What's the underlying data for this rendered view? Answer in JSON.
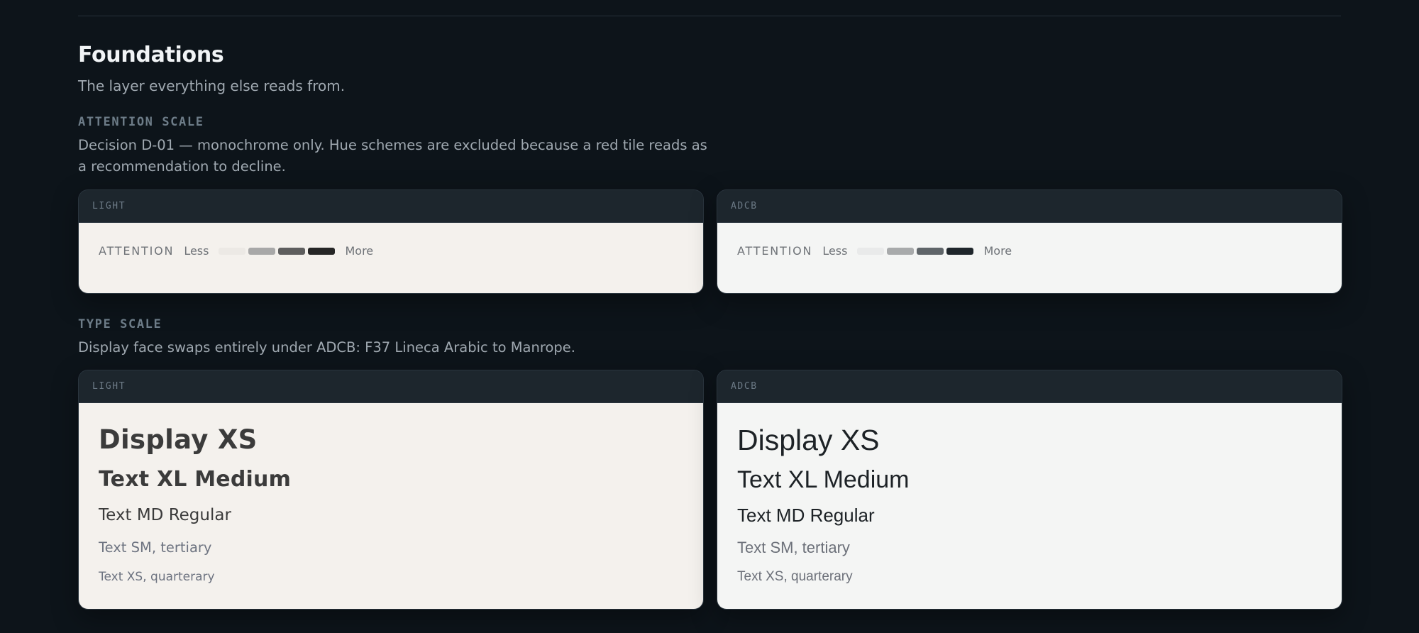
{
  "foundations": {
    "title": "Foundations",
    "subtitle": "The layer everything else reads from."
  },
  "attention_scale": {
    "eyebrow": "ATTENTION SCALE",
    "description": "Decision D-01 — monochrome only. Hue schemes are excluded because a red tile reads as a recommendation to decline.",
    "cards": [
      {
        "header": "LIGHT",
        "label": "ATTENTION",
        "less": "Less",
        "more": "More",
        "swatches": [
          "#ece9e5",
          "#a8a8a8",
          "#5e5e5e",
          "#262626"
        ]
      },
      {
        "header": "ADCB",
        "label": "ATTENTION",
        "less": "Less",
        "more": "More",
        "swatches": [
          "#e9eaea",
          "#a8aaab",
          "#5f6569",
          "#1f262b"
        ]
      }
    ]
  },
  "type_scale": {
    "eyebrow": "TYPE SCALE",
    "description": "Display face swaps entirely under ADCB: F37 Lineca Arabic to Manrope.",
    "cards": [
      {
        "header": "LIGHT",
        "samples": [
          "Display XS",
          "Text XL Medium",
          "Text MD Regular",
          "Text SM, tertiary",
          "Text XS, quarterary"
        ]
      },
      {
        "header": "ADCB",
        "samples": [
          "Display XS",
          "Text XL Medium",
          "Text MD Regular",
          "Text SM, tertiary",
          "Text XS, quarterary"
        ]
      }
    ]
  },
  "colors": {
    "page_bg": "#0d141a",
    "card_header_bg": "#1d262d",
    "light_surface": "#f4f1ed",
    "adcb_surface": "#f4f5f4"
  }
}
